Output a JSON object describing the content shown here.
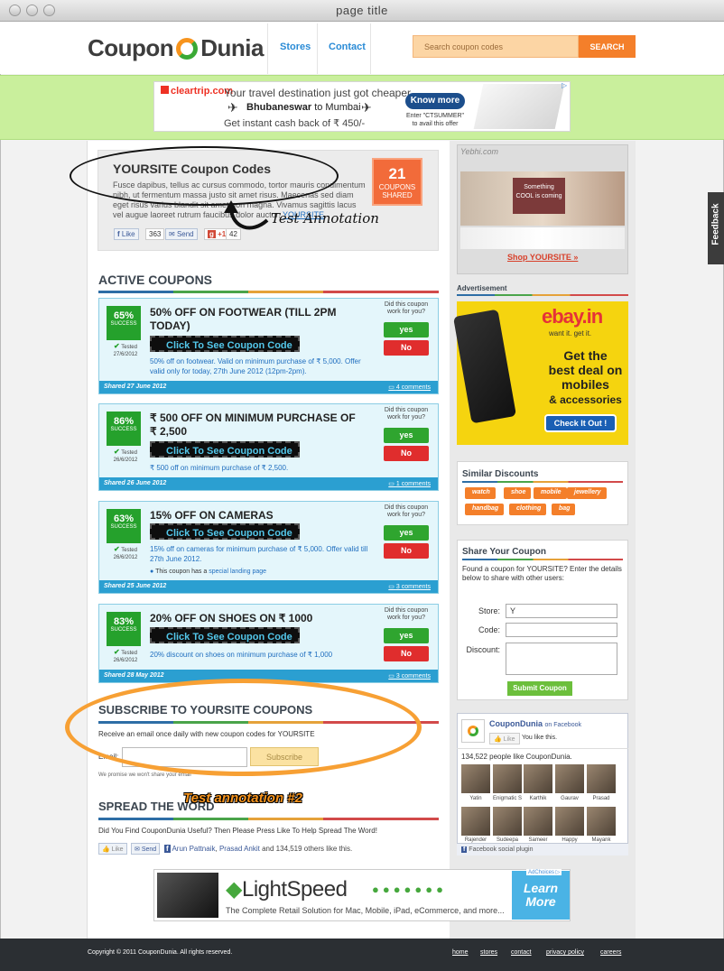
{
  "window": {
    "title": "page title"
  },
  "header": {
    "logo_left": "Coupon",
    "logo_right": "Dunia",
    "nav": [
      "Stores",
      "Contact"
    ],
    "search_placeholder": "Search coupon codes",
    "search_button": "SEARCH"
  },
  "top_ad": {
    "brand": "cleartrip.com",
    "line1": "Your travel destination just got cheaper",
    "route_from": "Bhubaneswar",
    "route_to": "to Mumbai",
    "line3": "Get instant cash back of ₹ 450/-",
    "know_more": "Know more",
    "promo_line1": "Enter \"CTSUMMER\"",
    "promo_line2": "to avail this offer"
  },
  "store": {
    "title": "YOURSITE Coupon Codes",
    "description": "Fusce dapibus, tellus ac cursus commodo, tortor mauris condimentum nibh, ut fermentum massa justo sit amet risus. Maecenas sed diam eget risus varius blandit sit amet non magna. Vivamus sagittis lacus vel augue laoreet rutrum faucibus dolor auctor.",
    "link": "YOURSITE",
    "coupon_count": "21",
    "coupon_count_label1": "COUPONS",
    "coupon_count_label2": "SHARED",
    "like_label": "Like",
    "like_count": "363",
    "send_label": "Send",
    "plusone_label": "+1",
    "plusone_count": "42"
  },
  "annotations": {
    "first": "Test Annotation",
    "second": "Test annotation #2"
  },
  "active_coupons": {
    "heading": "ACTIVE COUPONS",
    "work_question": "Did this coupon work for you?",
    "yes": "yes",
    "no": "No",
    "button_label": "Click To See Coupon Code",
    "tested_label": "Tested",
    "success_label": "SUCCESS",
    "items": [
      {
        "success": "65%",
        "tested_date": "27/6/2012",
        "title": "50% OFF ON FOOTWEAR (TILL 2PM TODAY)",
        "description": "50% off on footwear. Valid on minimum purchase of ₹ 5,000. Offer valid only for today, 27th June 2012 (12pm-2pm).",
        "shared": "Shared 27 June 2012",
        "comments": "4 comments"
      },
      {
        "success": "86%",
        "tested_date": "26/6/2012",
        "title": "₹ 500 OFF ON MINIMUM PURCHASE OF ₹ 2,500",
        "description": "₹ 500 off on minimum purchase of ₹ 2,500.",
        "shared": "Shared 26 June 2012",
        "comments": "1 comments"
      },
      {
        "success": "63%",
        "tested_date": "26/6/2012",
        "title": "15% OFF ON CAMERAS",
        "description": "15% off on cameras for minimum purchase of ₹ 5,000. Offer valid till 27th June 2012.",
        "landing_prefix": "This coupon has a",
        "landing_link": "special landing page",
        "shared": "Shared 25 June 2012",
        "comments": "3 comments"
      },
      {
        "success": "83%",
        "tested_date": "26/6/2012",
        "title": "20% OFF ON SHOES ON ₹ 1000",
        "description": "20% discount on shoes on minimum purchase of ₹ 1,000",
        "shared": "Shared 28 May 2012",
        "comments": "3 comments"
      }
    ]
  },
  "subscribe": {
    "heading": "SUBSCRIBE TO YOURSITE COUPONS",
    "text": "Receive an email once daily with new coupon codes for YOURSITE",
    "email_label": "Email:",
    "button": "Subscribe",
    "note": "We promise we won't share your email"
  },
  "spread": {
    "heading": "SPREAD THE WORD",
    "text": "Did You Find CouponDunia Useful? Then Please Press Like To Help Spread The Word!",
    "like": "Like",
    "send": "Send",
    "friends_link1": "Arun Pattnaik",
    "friends_link2": "Prasad Ankit",
    "friends_rest": "and 134,519 others like this."
  },
  "sidebar": {
    "yebhi_brand": "Yebhi.com",
    "yebhi_banner_line1": "Something",
    "yebhi_banner_line2": "COOL is coming",
    "shop_link": "Shop YOURSITE »",
    "ad_label": "Advertisement",
    "ebay": {
      "logo": "ebay.in",
      "tagline": "want it. get it.",
      "headline1": "Get the",
      "headline2": "best deal on",
      "headline3": "mobiles",
      "headline4": "& accessories",
      "cta": "Check It Out !"
    },
    "similar": {
      "heading": "Similar Discounts",
      "tags": [
        "watch",
        "shoe",
        "mobile",
        "jewellery",
        "handbag",
        "clothing",
        "bag"
      ]
    },
    "share": {
      "heading": "Share Your Coupon",
      "intro": "Found a coupon for YOURSITE? Enter the details below to share with other users:",
      "store_label": "Store:",
      "store_value": "Y",
      "code_label": "Code:",
      "discount_label": "Discount:",
      "submit": "Submit Coupon"
    },
    "facebook": {
      "page_name": "CouponDunia",
      "on_facebook": "on Facebook",
      "like": "Like",
      "you_like": "You like this.",
      "people": "134,522 people like CouponDunia.",
      "friends": [
        "Yatin",
        "Enigmatic S",
        "Karthik",
        "Gaurav",
        "Prasad",
        "Rajender",
        "Sudeepa",
        "Sameer",
        "Happy",
        "Mayank"
      ],
      "plugin": "Facebook social plugin"
    }
  },
  "bottom_ad": {
    "brand": "LightSpeed",
    "tagline": "The Complete Retail Solution for Mac, Mobile, iPad, eCommerce, and more...",
    "cta": "Learn More",
    "adchoices": "AdChoices"
  },
  "footer": {
    "copyright": "Copyright © 2011 CouponDunia. All rights reserved.",
    "links": [
      "home",
      "stores",
      "contact",
      "privacy policy",
      "careers"
    ]
  },
  "feedback_tab": "Feedback"
}
